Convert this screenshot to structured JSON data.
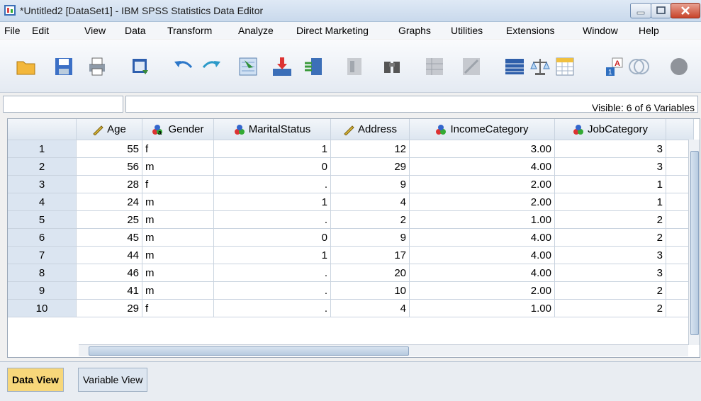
{
  "window": {
    "title": "*Untitled2 [DataSet1] - IBM SPSS Statistics Data Editor"
  },
  "menu": [
    {
      "label": "File"
    },
    {
      "label": "Edit"
    },
    {
      "label": "View"
    },
    {
      "label": "Data"
    },
    {
      "label": "Transform"
    },
    {
      "label": "Analyze"
    },
    {
      "label": "Direct Marketing"
    },
    {
      "label": "Graphs"
    },
    {
      "label": "Utilities"
    },
    {
      "label": "Extensions"
    },
    {
      "label": "Window"
    },
    {
      "label": "Help"
    }
  ],
  "cellbar": {
    "visible_text": "Visible: 6 of 6 Variables"
  },
  "columns": [
    {
      "label": "Age",
      "icon": "scale-ruler-icon"
    },
    {
      "label": "Gender",
      "icon": "nominal-string-icon"
    },
    {
      "label": "MaritalStatus",
      "icon": "nominal-icon"
    },
    {
      "label": "Address",
      "icon": "scale-ruler-icon"
    },
    {
      "label": "IncomeCategory",
      "icon": "nominal-icon"
    },
    {
      "label": "JobCategory",
      "icon": "nominal-icon"
    }
  ],
  "rows": [
    {
      "id": "1",
      "Age": "55",
      "Gender": "f",
      "MaritalStatus": "1",
      "Address": "12",
      "IncomeCategory": "3.00",
      "JobCategory": "3"
    },
    {
      "id": "2",
      "Age": "56",
      "Gender": "m",
      "MaritalStatus": "0",
      "Address": "29",
      "IncomeCategory": "4.00",
      "JobCategory": "3"
    },
    {
      "id": "3",
      "Age": "28",
      "Gender": "f",
      "MaritalStatus": ".",
      "Address": "9",
      "IncomeCategory": "2.00",
      "JobCategory": "1"
    },
    {
      "id": "4",
      "Age": "24",
      "Gender": "m",
      "MaritalStatus": "1",
      "Address": "4",
      "IncomeCategory": "2.00",
      "JobCategory": "1"
    },
    {
      "id": "5",
      "Age": "25",
      "Gender": "m",
      "MaritalStatus": ".",
      "Address": "2",
      "IncomeCategory": "1.00",
      "JobCategory": "2"
    },
    {
      "id": "6",
      "Age": "45",
      "Gender": "m",
      "MaritalStatus": "0",
      "Address": "9",
      "IncomeCategory": "4.00",
      "JobCategory": "2"
    },
    {
      "id": "7",
      "Age": "44",
      "Gender": "m",
      "MaritalStatus": "1",
      "Address": "17",
      "IncomeCategory": "4.00",
      "JobCategory": "3"
    },
    {
      "id": "8",
      "Age": "46",
      "Gender": "m",
      "MaritalStatus": ".",
      "Address": "20",
      "IncomeCategory": "4.00",
      "JobCategory": "3"
    },
    {
      "id": "9",
      "Age": "41",
      "Gender": "m",
      "MaritalStatus": ".",
      "Address": "10",
      "IncomeCategory": "2.00",
      "JobCategory": "2"
    },
    {
      "id": "10",
      "Age": "29",
      "Gender": "f",
      "MaritalStatus": ".",
      "Address": "4",
      "IncomeCategory": "1.00",
      "JobCategory": "2"
    }
  ],
  "tabs": [
    {
      "label": "Data View",
      "active": true
    },
    {
      "label": "Variable View",
      "active": false
    }
  ],
  "colors": {
    "header_bg": "#dde6f0",
    "active_tab": "#f7d77a",
    "row_header": "#dbe5f1"
  }
}
